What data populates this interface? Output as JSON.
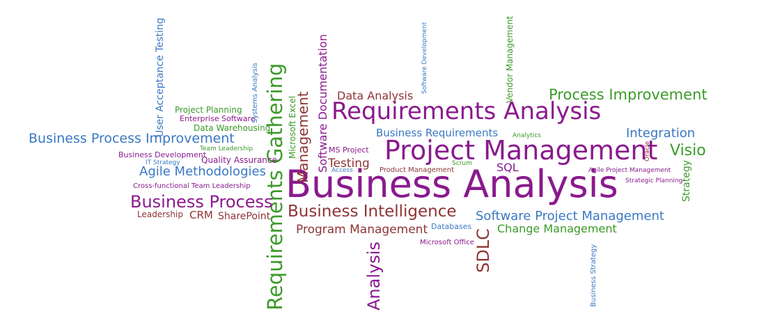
{
  "colors": {
    "purple": "#8a1a8e",
    "green": "#3b9a29",
    "blue": "#3a78c3",
    "brown": "#8e3434"
  },
  "words": [
    {
      "text": "Business Analysis",
      "color": "purple",
      "rotated": false
    },
    {
      "text": "Project Management",
      "color": "purple",
      "rotated": false
    },
    {
      "text": "Requirements Analysis",
      "color": "purple",
      "rotated": false
    },
    {
      "text": "Requirements Gathering",
      "color": "green",
      "rotated": true
    },
    {
      "text": "Business Process",
      "color": "purple",
      "rotated": false
    },
    {
      "text": "Business Intelligence",
      "color": "brown",
      "rotated": false
    },
    {
      "text": "Process Improvement",
      "color": "green",
      "rotated": false
    },
    {
      "text": "Business Process Improvement",
      "color": "blue",
      "rotated": false
    },
    {
      "text": "Agile Methodologies",
      "color": "blue",
      "rotated": false
    },
    {
      "text": "Software Project Management",
      "color": "blue",
      "rotated": false
    },
    {
      "text": "Program Management",
      "color": "brown",
      "rotated": false
    },
    {
      "text": "Change Management",
      "color": "green",
      "rotated": false
    },
    {
      "text": "Integration",
      "color": "blue",
      "rotated": false
    },
    {
      "text": "Visio",
      "color": "green",
      "rotated": false
    },
    {
      "text": "Analysis",
      "color": "purple",
      "rotated": true
    },
    {
      "text": "SDLC",
      "color": "brown",
      "rotated": true
    },
    {
      "text": "Management",
      "color": "brown",
      "rotated": true
    },
    {
      "text": "Software Documentation",
      "color": "purple",
      "rotated": true
    },
    {
      "text": "Data Analysis",
      "color": "brown",
      "rotated": false
    },
    {
      "text": "Business Requirements",
      "color": "blue",
      "rotated": false
    },
    {
      "text": "SQL",
      "color": "purple",
      "rotated": false
    },
    {
      "text": "Testing",
      "color": "brown",
      "rotated": false
    },
    {
      "text": "CRM",
      "color": "brown",
      "rotated": false
    },
    {
      "text": "SharePoint",
      "color": "brown",
      "rotated": false
    },
    {
      "text": "User Acceptance Testing",
      "color": "blue",
      "rotated": true
    },
    {
      "text": "Strategy",
      "color": "green",
      "rotated": true
    },
    {
      "text": "Microsoft Excel",
      "color": "green",
      "rotated": true
    },
    {
      "text": "Vendor Management",
      "color": "green",
      "rotated": true
    },
    {
      "text": "Project Planning",
      "color": "green",
      "rotated": false
    },
    {
      "text": "Enterprise Software",
      "color": "purple",
      "rotated": false
    },
    {
      "text": "Data Warehousing",
      "color": "green",
      "rotated": false
    },
    {
      "text": "Systems Analysis",
      "color": "blue",
      "rotated": true
    },
    {
      "text": "Business Development",
      "color": "purple",
      "rotated": false
    },
    {
      "text": "Team Leadership",
      "color": "green",
      "rotated": false
    },
    {
      "text": "IT Strategy",
      "color": "blue",
      "rotated": false
    },
    {
      "text": "Quality Assurance",
      "color": "purple",
      "rotated": false
    },
    {
      "text": "Cross-functional Team Leadership",
      "color": "purple",
      "rotated": false
    },
    {
      "text": "Leadership",
      "color": "brown",
      "rotated": false
    },
    {
      "text": "MS Project",
      "color": "purple",
      "rotated": false
    },
    {
      "text": "Access",
      "color": "blue",
      "rotated": false
    },
    {
      "text": "Product Management",
      "color": "brown",
      "rotated": false
    },
    {
      "text": "Scrum",
      "color": "green",
      "rotated": false
    },
    {
      "text": "Software Development",
      "color": "blue",
      "rotated": true
    },
    {
      "text": "Analytics",
      "color": "green",
      "rotated": false
    },
    {
      "text": "Oracle",
      "color": "brown",
      "rotated": true
    },
    {
      "text": "Agile Project Management",
      "color": "purple",
      "rotated": false
    },
    {
      "text": "Strategic Planning",
      "color": "purple",
      "rotated": false
    },
    {
      "text": "Databases",
      "color": "blue",
      "rotated": false
    },
    {
      "text": "Microsoft Office",
      "color": "purple",
      "rotated": false
    },
    {
      "text": "Business Strategy",
      "color": "blue",
      "rotated": true
    }
  ]
}
